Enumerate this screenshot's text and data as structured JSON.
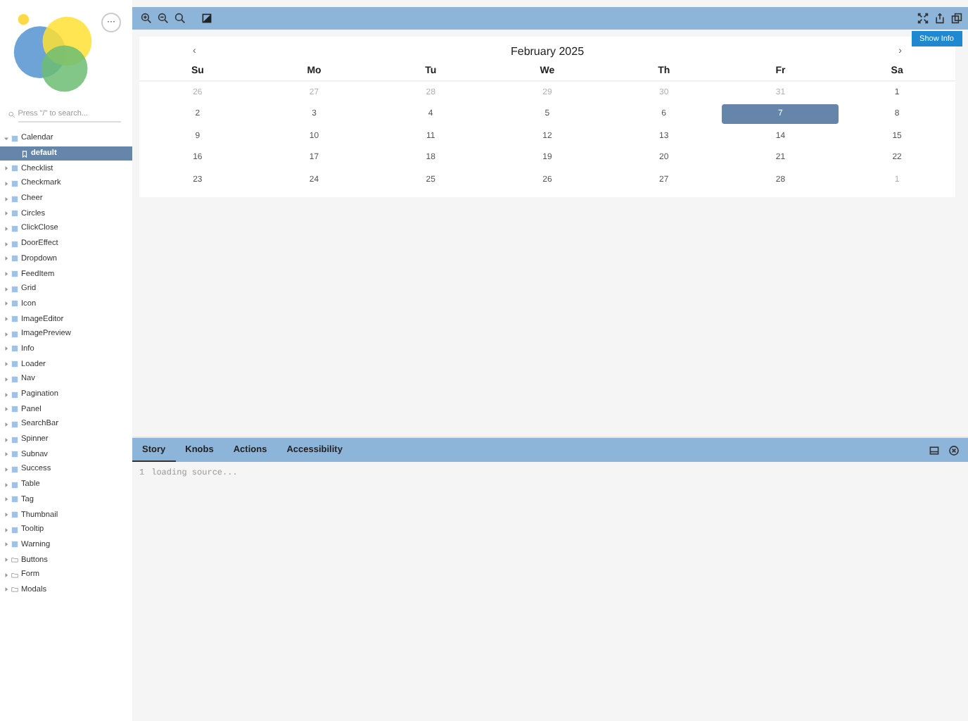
{
  "sidebar": {
    "menu_button": "···",
    "search": {
      "placeholder": "Press \"/\" to search..."
    },
    "tree": [
      {
        "label": "Calendar",
        "kind": "component",
        "expanded": true,
        "children": [
          {
            "label": "default",
            "selected": true
          }
        ]
      },
      {
        "label": "Checklist",
        "kind": "component",
        "expanded": false
      },
      {
        "label": "Checkmark",
        "kind": "component",
        "expanded": false
      },
      {
        "label": "Cheer",
        "kind": "component",
        "expanded": false
      },
      {
        "label": "Circles",
        "kind": "component",
        "expanded": false
      },
      {
        "label": "ClickClose",
        "kind": "component",
        "expanded": false
      },
      {
        "label": "DoorEffect",
        "kind": "component",
        "expanded": false
      },
      {
        "label": "Dropdown",
        "kind": "component",
        "expanded": false
      },
      {
        "label": "FeedItem",
        "kind": "component",
        "expanded": false
      },
      {
        "label": "Grid",
        "kind": "component",
        "expanded": false
      },
      {
        "label": "Icon",
        "kind": "component",
        "expanded": false
      },
      {
        "label": "ImageEditor",
        "kind": "component",
        "expanded": false
      },
      {
        "label": "ImagePreview",
        "kind": "component",
        "expanded": false
      },
      {
        "label": "Info",
        "kind": "component",
        "expanded": false
      },
      {
        "label": "Loader",
        "kind": "component",
        "expanded": false
      },
      {
        "label": "Nav",
        "kind": "component",
        "expanded": false
      },
      {
        "label": "Pagination",
        "kind": "component",
        "expanded": false
      },
      {
        "label": "Panel",
        "kind": "component",
        "expanded": false
      },
      {
        "label": "SearchBar",
        "kind": "component",
        "expanded": false
      },
      {
        "label": "Spinner",
        "kind": "component",
        "expanded": false
      },
      {
        "label": "Subnav",
        "kind": "component",
        "expanded": false
      },
      {
        "label": "Success",
        "kind": "component",
        "expanded": false
      },
      {
        "label": "Table",
        "kind": "component",
        "expanded": false
      },
      {
        "label": "Tag",
        "kind": "component",
        "expanded": false
      },
      {
        "label": "Thumbnail",
        "kind": "component",
        "expanded": false
      },
      {
        "label": "Tooltip",
        "kind": "component",
        "expanded": false
      },
      {
        "label": "Warning",
        "kind": "component",
        "expanded": false
      },
      {
        "label": "Buttons",
        "kind": "folder",
        "expanded": false
      },
      {
        "label": "Form",
        "kind": "folder",
        "expanded": false
      },
      {
        "label": "Modals",
        "kind": "folder",
        "expanded": false
      }
    ]
  },
  "preview": {
    "show_info": "Show Info",
    "calendar": {
      "prev": "‹",
      "title": "February 2025",
      "next": "›",
      "weekdays": [
        "Su",
        "Mo",
        "Tu",
        "We",
        "Th",
        "Fr",
        "Sa"
      ],
      "weeks": [
        [
          {
            "day": "26",
            "kind": "other",
            "selected": false
          },
          {
            "day": "27",
            "kind": "other",
            "selected": false
          },
          {
            "day": "28",
            "kind": "other",
            "selected": false
          },
          {
            "day": "29",
            "kind": "other",
            "selected": false
          },
          {
            "day": "30",
            "kind": "other",
            "selected": false
          },
          {
            "day": "31",
            "kind": "other",
            "selected": false
          },
          {
            "day": "1",
            "kind": "day",
            "selected": false
          }
        ],
        [
          {
            "day": "2",
            "kind": "day",
            "selected": false
          },
          {
            "day": "3",
            "kind": "day",
            "selected": false
          },
          {
            "day": "4",
            "kind": "day",
            "selected": false
          },
          {
            "day": "5",
            "kind": "day",
            "selected": false
          },
          {
            "day": "6",
            "kind": "day",
            "selected": false
          },
          {
            "day": "7",
            "kind": "day",
            "selected": true
          },
          {
            "day": "8",
            "kind": "day",
            "selected": false
          }
        ],
        [
          {
            "day": "9",
            "kind": "day",
            "selected": false
          },
          {
            "day": "10",
            "kind": "day",
            "selected": false
          },
          {
            "day": "11",
            "kind": "day",
            "selected": false
          },
          {
            "day": "12",
            "kind": "day",
            "selected": false
          },
          {
            "day": "13",
            "kind": "day",
            "selected": false
          },
          {
            "day": "14",
            "kind": "day",
            "selected": false
          },
          {
            "day": "15",
            "kind": "day",
            "selected": false
          }
        ],
        [
          {
            "day": "16",
            "kind": "day",
            "selected": false
          },
          {
            "day": "17",
            "kind": "day",
            "selected": false
          },
          {
            "day": "18",
            "kind": "day",
            "selected": false
          },
          {
            "day": "19",
            "kind": "day",
            "selected": false
          },
          {
            "day": "20",
            "kind": "day",
            "selected": false
          },
          {
            "day": "21",
            "kind": "day",
            "selected": false
          },
          {
            "day": "22",
            "kind": "day",
            "selected": false
          }
        ],
        [
          {
            "day": "23",
            "kind": "day",
            "selected": false
          },
          {
            "day": "24",
            "kind": "day",
            "selected": false
          },
          {
            "day": "25",
            "kind": "day",
            "selected": false
          },
          {
            "day": "26",
            "kind": "day",
            "selected": false
          },
          {
            "day": "27",
            "kind": "day",
            "selected": false
          },
          {
            "day": "28",
            "kind": "day",
            "selected": false
          },
          {
            "day": "1",
            "kind": "other",
            "selected": false
          }
        ]
      ]
    }
  },
  "addons": {
    "tabs": [
      {
        "label": "Story",
        "selected": true
      },
      {
        "label": "Knobs",
        "selected": false
      },
      {
        "label": "Actions",
        "selected": false
      },
      {
        "label": "Accessibility",
        "selected": false
      }
    ],
    "source": {
      "line_number": "1",
      "text": "loading source..."
    }
  }
}
